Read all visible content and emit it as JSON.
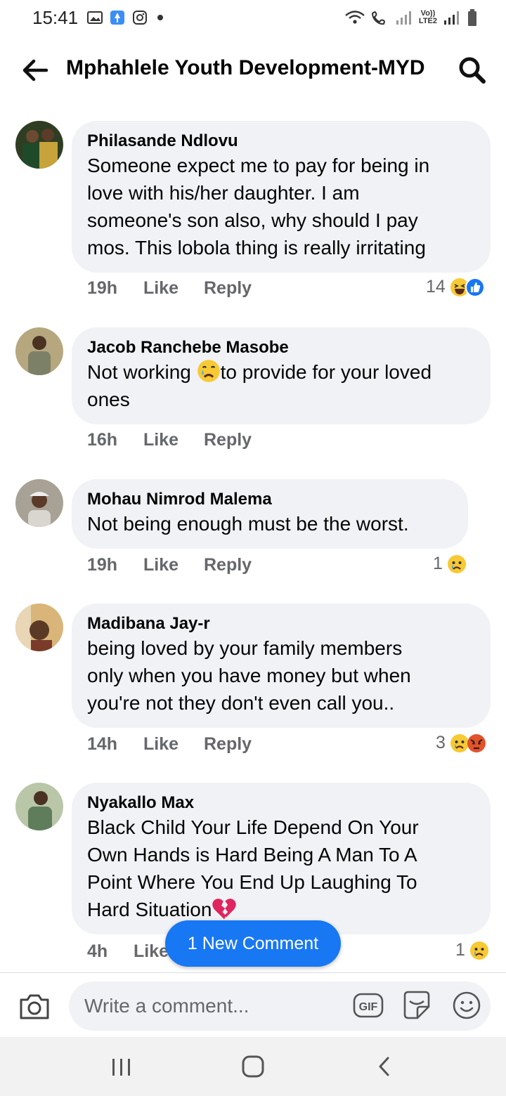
{
  "status_bar": {
    "time": "15:41",
    "left_icons": [
      "gallery-icon",
      "app-icon",
      "instagram-icon",
      "dot"
    ],
    "right_icons": [
      "wifi-icon",
      "wifi-calling-icon",
      "signal-icon",
      "volte-label",
      "signal-icon",
      "battery-icon"
    ],
    "volte_label_top": "Vo))",
    "volte_label_bottom": "LTE2"
  },
  "header": {
    "title": "Mphahlele Youth Development-MYD",
    "back_icon": "arrow-left-icon",
    "search_icon": "search-icon"
  },
  "comments": [
    {
      "author": "Philasande Ndlovu",
      "text": "Someone expect me to pay for being in\nlove with his/her daughter. I am\nsomeone's son also, why should I pay\nmos. This lobola thing is really irritating",
      "time": "19h",
      "like_label": "Like",
      "reply_label": "Reply",
      "reaction_count": "14",
      "reactions": [
        "laughing-emoji",
        "like-reaction"
      ],
      "avatar_color": "#3b4a2a"
    },
    {
      "author": "Jacob Ranchebe Masobe",
      "text_before": "Not working ",
      "text_after": "to provide for your loved\nones",
      "inline_emoji": "crying-emoji",
      "time": "16h",
      "like_label": "Like",
      "reply_label": "Reply",
      "avatar_color": "#8a7a52"
    },
    {
      "author": "Mohau Nimrod Malema",
      "text": "Not being enough must be the worst.",
      "time": "19h",
      "like_label": "Like",
      "reply_label": "Reply",
      "reaction_count": "1",
      "reactions": [
        "sad-emoji"
      ],
      "avatar_color": "#9a9488"
    },
    {
      "author": "Madibana Jay-r",
      "text": "being loved by your family members\nonly when you have money but when\nyou're not they don't even call you..",
      "time": "14h",
      "like_label": "Like",
      "reply_label": "Reply",
      "reaction_count": "3",
      "reactions": [
        "sad-emoji",
        "angry-emoji"
      ],
      "avatar_color": "#c9a26a"
    },
    {
      "author": "Nyakallo Max",
      "text": "Black Child Your Life Depend On Your\nOwn Hands is Hard Being A Man To A\nPoint Where You End Up Laughing To\nHard Situation",
      "trailing_emoji": "broken-heart-emoji",
      "time": "4h",
      "like_label": "Like",
      "reaction_count": "1",
      "reactions": [
        "sad-emoji"
      ],
      "avatar_color": "#5f7d5a"
    }
  ],
  "new_comment_pill": "1 New Comment",
  "composer": {
    "placeholder": "Write a comment...",
    "gif_label": "GIF",
    "icons": [
      "camera-icon",
      "gif-icon",
      "sticker-icon",
      "emoji-icon"
    ]
  },
  "navbar": {
    "icons": [
      "recent-apps-icon",
      "home-icon",
      "back-icon"
    ]
  },
  "colors": {
    "accent": "#1877f2",
    "bubble": "#f0f2f5",
    "secondary_text": "#65676b",
    "angry": "#e0532b",
    "emoji_yellow": "#f7c933"
  }
}
